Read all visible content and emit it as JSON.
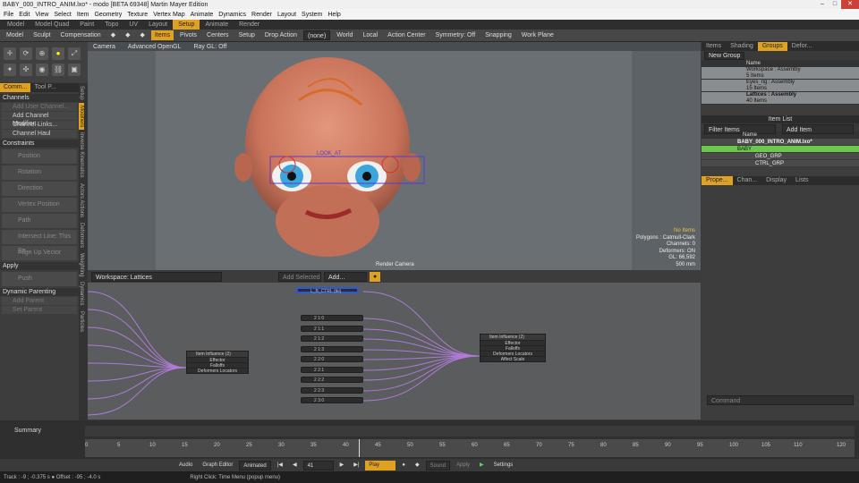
{
  "window": {
    "title": "BABY_000_INTRO_ANIM.lxo* - modo [BETA 69348] Martin Mayer Edition"
  },
  "menu": [
    "File",
    "Edit",
    "View",
    "Select",
    "Item",
    "Geometry",
    "Texture",
    "Vertex Map",
    "Animate",
    "Dynamics",
    "Render",
    "Layout",
    "System",
    "Help"
  ],
  "tabs": [
    "Model",
    "Model Quad",
    "Paint",
    "Topo",
    "UV",
    "Layout",
    "Setup",
    "Animate",
    "Render"
  ],
  "active_tab": "Setup",
  "toolbar": {
    "model": "Model",
    "sculpt": "Sculpt",
    "compensation": "Compensation",
    "items": "Items",
    "pivots": "Pivots",
    "centers": "Centers",
    "setup": "Setup",
    "drop_action": "Drop Action",
    "drop_value": "(none)",
    "world": "World",
    "local": "Local",
    "action_center": "Action Center",
    "symmetry": "Symmetry: Off",
    "snapping": "Snapping",
    "work_plane": "Work Plane"
  },
  "left_tabs": [
    "Comm...",
    "Tool P..."
  ],
  "left_panel": {
    "channels": "Channels",
    "add_user_channel": "Add User Channel...",
    "add_channel_modifier": "Add Channel Modifier...",
    "channel_links": "Channel Links...",
    "channel_haul": "Channel Haul",
    "constraints": "Constraints",
    "c_position": "Position",
    "c_rotation": "Rotation",
    "c_direction": "Direction",
    "c_vertex": "Vertex Position",
    "c_path": "Path",
    "c_intersect": "Intersect Line: This Re...",
    "c_align": "Align Up Vector",
    "apply": "Apply",
    "push": "Push",
    "dyn_parenting": "Dynamic Parenting",
    "add_parent": "Add Parent",
    "set_parent": "Set Parent"
  },
  "left_vertical_tabs": [
    "Setup",
    "Modifiers",
    "Inverse Kinematics",
    "Actors Actions",
    "Deformers",
    "Weighting",
    "Dynamics",
    "Particles"
  ],
  "viewport": {
    "camera": "Camera",
    "shading": "Advanced OpenGL",
    "ray_gl": "Ray GL: Off",
    "info": [
      "No Items",
      "Polygons : Catmull-Clark",
      "Channels: 0",
      "Deformers: ON",
      "GL: 66,592",
      "500 mm"
    ],
    "render_label": "Render Camera",
    "eye_label": "LOOK_AT"
  },
  "schematic": {
    "workspace": "Workspace: Lattices",
    "add_selected": "Add Selected",
    "add": "Add...",
    "top_pill": "L_B_CTRL (tki)",
    "left_node": {
      "title": "Item Influence (2)",
      "rows": [
        "Effector",
        "Falloffs",
        "Deformers Locators"
      ]
    },
    "right_node": {
      "title": "Item Influence (2)",
      "rows": [
        "Effector",
        "Falloffs",
        "Deformers Locators",
        "Affect Scale"
      ]
    },
    "pills": [
      "2 1:0",
      "2 1:1",
      "2 1:2",
      "2 1:3",
      "2 2:0",
      "2 2:1",
      "2 2:2",
      "2 2:3",
      "2 3:0"
    ]
  },
  "right_tabs_top": [
    "Items",
    "Shading",
    "Groups",
    "Defor..."
  ],
  "groups_button": "New Group",
  "groups_header": "Name",
  "groups": [
    {
      "name": "Workspace : Assembly",
      "count": "5 Items"
    },
    {
      "name": "Eyes_rig : Assembly",
      "count": "15 Items"
    },
    {
      "name": "Lattices : Assembly",
      "count": "40 Items"
    }
  ],
  "item_list": {
    "title": "Item List",
    "filter": "Filter Items",
    "add_item": "Add Item",
    "header": "Name",
    "rows": [
      "BABY_000_INTRO_ANIM.lxo*",
      "BABY",
      "GEO_GRP",
      "CTRL_GRP"
    ]
  },
  "right_tabs_bottom": [
    "Prope...",
    "Chan...",
    "Display",
    "Lists"
  ],
  "command": "Command",
  "timeline": {
    "label": "Summary",
    "ticks": [
      "0",
      "5",
      "10",
      "15",
      "20",
      "25",
      "30",
      "35",
      "40",
      "45",
      "50",
      "55",
      "60",
      "65",
      "70",
      "75",
      "80",
      "85",
      "90",
      "95",
      "100",
      "105",
      "110",
      "120"
    ]
  },
  "transport": {
    "audio": "Audio",
    "graph": "Graph Editor",
    "mode": "Animated",
    "frame": "41",
    "play": "Play",
    "sound": "Sound",
    "apply": "Apply",
    "settings": "Settings"
  },
  "status": {
    "left": "Track : -9 ; -0.375 s ● Offset : -95 ; -4.0 s",
    "center": "Right Click: Time Menu (popup menu)"
  }
}
